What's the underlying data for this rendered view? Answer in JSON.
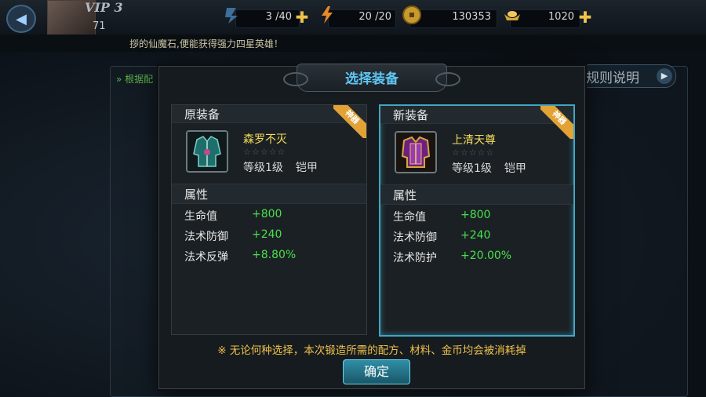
{
  "top": {
    "vip": "VIP 3",
    "level": "71",
    "stamina": "3 /40",
    "energy": "20 /20",
    "coins": "130353",
    "ingots": "1020"
  },
  "marquee": "拶的仙魔石,便能获得强力四星英雄！",
  "bg": {
    "hint": "» 根据配",
    "rules_label": "规则说明"
  },
  "dialog": {
    "title": "选择装备",
    "left": {
      "header": "原装备",
      "name": "森罗不灭",
      "stars": "☆☆☆☆☆",
      "level": "等级1级",
      "type": "铠甲",
      "ribbon": "神器",
      "attr_header": "属性",
      "attrs": [
        {
          "k": "生命值",
          "v": "+800"
        },
        {
          "k": "法术防御",
          "v": "+240"
        },
        {
          "k": "法术反弹",
          "v": "+8.80%"
        }
      ]
    },
    "right": {
      "header": "新装备",
      "name": "上清天尊",
      "stars": "☆☆☆☆☆",
      "level": "等级1级",
      "type": "铠甲",
      "ribbon": "神器",
      "attr_header": "属性",
      "attrs": [
        {
          "k": "生命值",
          "v": "+800"
        },
        {
          "k": "法术防御",
          "v": "+240"
        },
        {
          "k": "法术防护",
          "v": "+20.00%"
        }
      ]
    },
    "notice": "※ 无论何种选择，本次锻造所需的配方、材料、金币均会被消耗掉",
    "confirm": "确定"
  },
  "colors": {
    "title": "#5ec7f4",
    "item_name": "#f4dc5b",
    "attr_value": "#49e04b",
    "notice": "#f0c24a",
    "selected_border": "#3fa6c4"
  }
}
